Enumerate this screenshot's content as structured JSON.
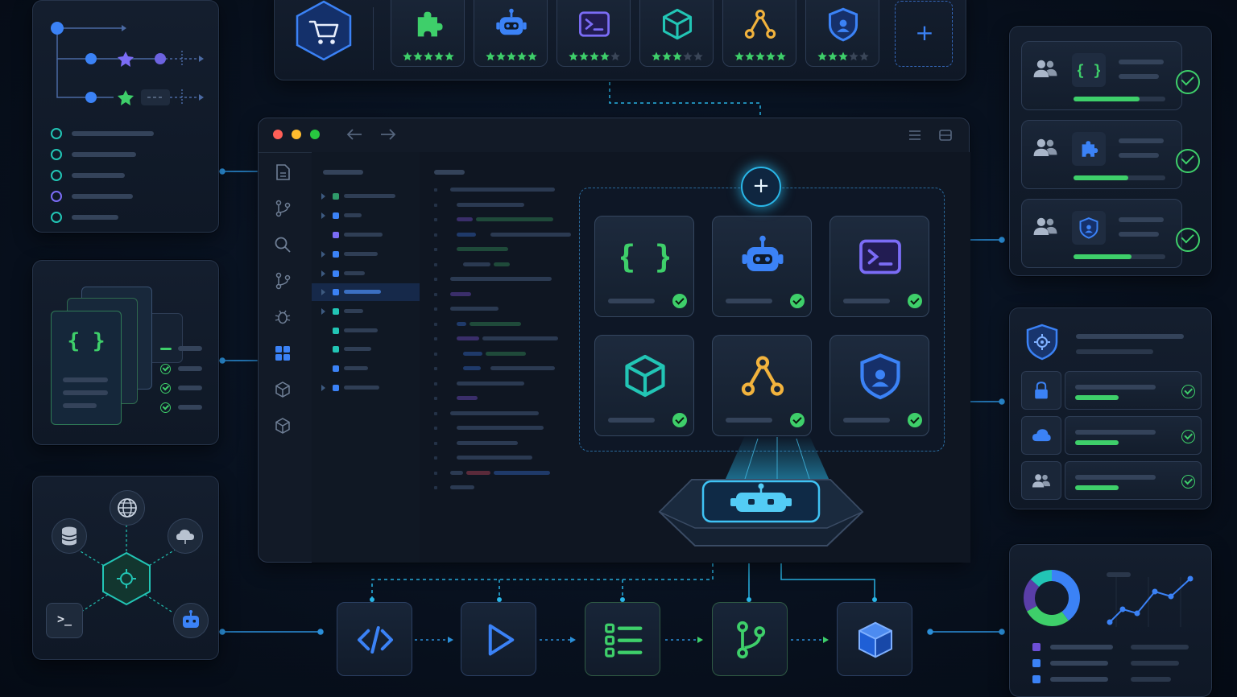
{
  "window": {
    "dots": [
      "#ff5f57",
      "#febc2e",
      "#28c840"
    ],
    "nav_back_icon": "arrow-left-icon",
    "nav_forward_icon": "arrow-right-icon"
  },
  "marketplace": {
    "store_icon": "shopping-cart-icon",
    "extensions": [
      {
        "icon": "puzzle-icon",
        "stars": 5,
        "color": "#3ecf6a"
      },
      {
        "icon": "robot-icon",
        "stars": 5,
        "color": "#3b82f6"
      },
      {
        "icon": "terminal-icon",
        "stars": 4,
        "color": "#7b6cf6"
      },
      {
        "icon": "cube-icon",
        "stars": 3,
        "color": "#22c5b5"
      },
      {
        "icon": "graph-icon",
        "stars": 5,
        "color": "#f2b33d"
      },
      {
        "icon": "shield-icon",
        "stars": 3,
        "color": "#3b82f6"
      }
    ],
    "add_label": "+"
  },
  "installed_grid": {
    "add_label": "+",
    "tiles": [
      {
        "icon": "braces-icon",
        "color": "#3ecf6a",
        "glyph": "{ }"
      },
      {
        "icon": "robot-icon",
        "color": "#3b82f6"
      },
      {
        "icon": "terminal-icon",
        "color": "#7b6cf6",
        "glyph": ">_"
      },
      {
        "icon": "cube-icon",
        "color": "#22c5b5"
      },
      {
        "icon": "graph-icon",
        "color": "#f2b33d"
      },
      {
        "icon": "shield-icon",
        "color": "#3b82f6"
      }
    ]
  },
  "pipeline": {
    "steps": [
      {
        "icon": "code-icon",
        "glyph": "</>",
        "color": "#3b82f6"
      },
      {
        "icon": "play-icon",
        "color": "#3b82f6"
      },
      {
        "icon": "checklist-icon",
        "color": "#3ecf6a"
      },
      {
        "icon": "branch-icon",
        "color": "#3ecf6a"
      },
      {
        "icon": "package-icon",
        "color": "#3b82f6"
      }
    ]
  },
  "left_panels": {
    "code_glyph": "{ }",
    "terminal_glyph": ">_"
  },
  "colors": {
    "accent": "#3b82f6",
    "success": "#3ecf6a",
    "teal": "#22c5b5",
    "purple": "#7b6cf6",
    "amber": "#f2b33d"
  }
}
